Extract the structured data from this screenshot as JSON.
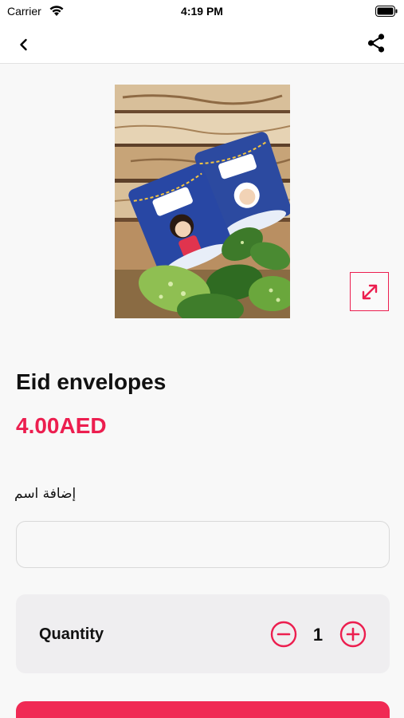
{
  "status_bar": {
    "carrier": "Carrier",
    "time": "4:19 PM"
  },
  "nav": {
    "back_icon": "chevron-left-icon",
    "share_icon": "share-icon"
  },
  "product": {
    "image": "eid-envelopes-photo",
    "expand_icon": "expand-icon",
    "title": "Eid envelopes",
    "price": "4.00AED"
  },
  "name_field": {
    "label": "إضافة اسم",
    "value": ""
  },
  "quantity": {
    "label": "Quantity",
    "value": "1",
    "minus_icon": "minus-circle-icon",
    "plus_icon": "plus-circle-icon"
  },
  "colors": {
    "accent": "#ec1e4f",
    "background": "#f8f8f8",
    "card": "#efeef0"
  }
}
